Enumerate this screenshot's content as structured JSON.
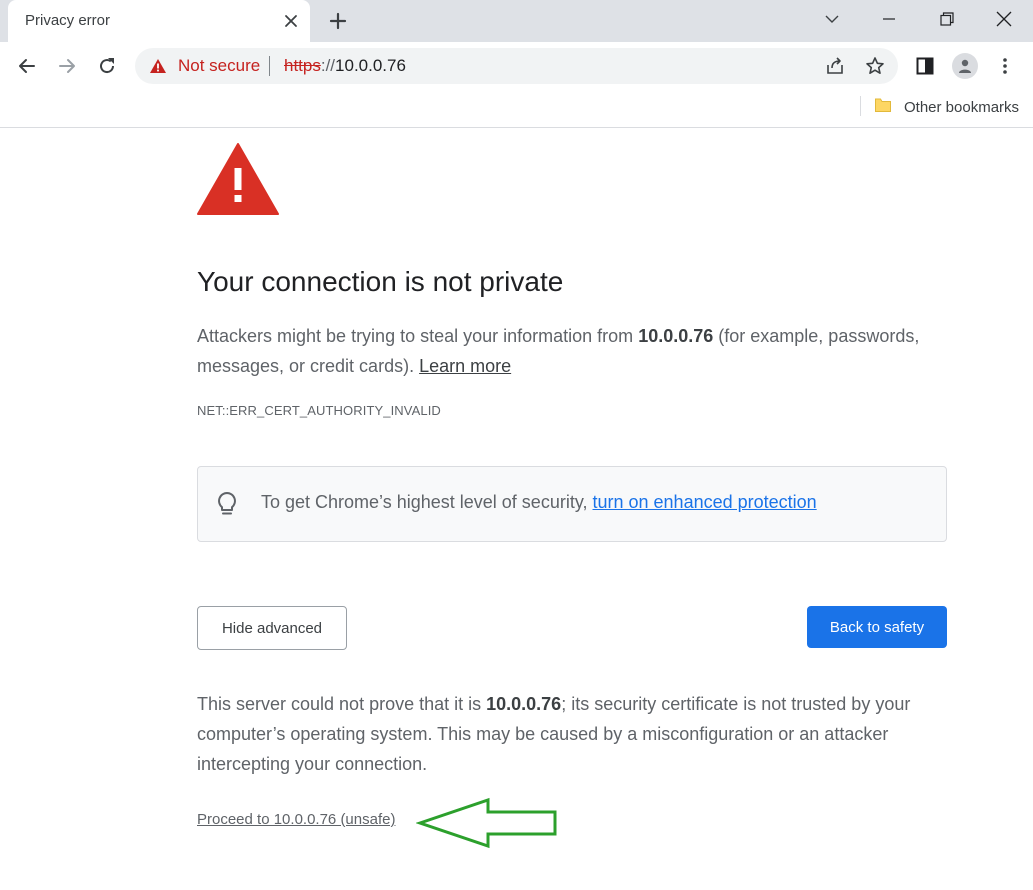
{
  "tab": {
    "title": "Privacy error"
  },
  "toolbar": {
    "security_label": "Not secure",
    "url_scheme": "https",
    "url_separator": "://",
    "url_host": "10.0.0.76"
  },
  "bookmarks": {
    "other_bookmarks_label": "Other bookmarks"
  },
  "interstitial": {
    "heading": "Your connection is not private",
    "intro_before": "Attackers might be trying to steal your information from ",
    "intro_host": "10.0.0.76",
    "intro_after": " (for example, passwords, messages, or credit cards). ",
    "learn_more_label": "Learn more",
    "error_code": "NET::ERR_CERT_AUTHORITY_INVALID",
    "promo_text": "To get Chrome’s highest level of security, ",
    "promo_link": "turn on enhanced protection",
    "hide_advanced_label": "Hide advanced",
    "back_to_safety_label": "Back to safety",
    "details_before": "This server could not prove that it is ",
    "details_host": "10.0.0.76",
    "details_after": "; its security certificate is not trusted by your computer’s operating system. This may be caused by a misconfiguration or an attacker intercepting your connection.",
    "proceed_label": "Proceed to 10.0.0.76 (unsafe)"
  },
  "colors": {
    "warning_red": "#d93025",
    "primary_blue": "#1a73e8",
    "annotation_green": "#2ca02c"
  },
  "icons": {
    "tab_close": "close-icon",
    "new_tab": "plus-icon",
    "tab_search": "chevron-down-icon",
    "minimize": "minimize-icon",
    "restore": "restore-icon",
    "close_window": "close-icon",
    "back": "arrow-left-icon",
    "forward": "arrow-right-icon",
    "reload": "reload-icon",
    "not_secure": "warning-triangle-icon",
    "share": "share-icon",
    "bookmark": "star-icon",
    "side_panel": "side-panel-icon",
    "profile": "person-icon",
    "menu": "kebab-menu-icon",
    "folder": "folder-icon",
    "error_warning": "warning-triangle-icon",
    "lightbulb": "lightbulb-icon",
    "annotation_arrow": "arrow-left-outline-icon"
  }
}
